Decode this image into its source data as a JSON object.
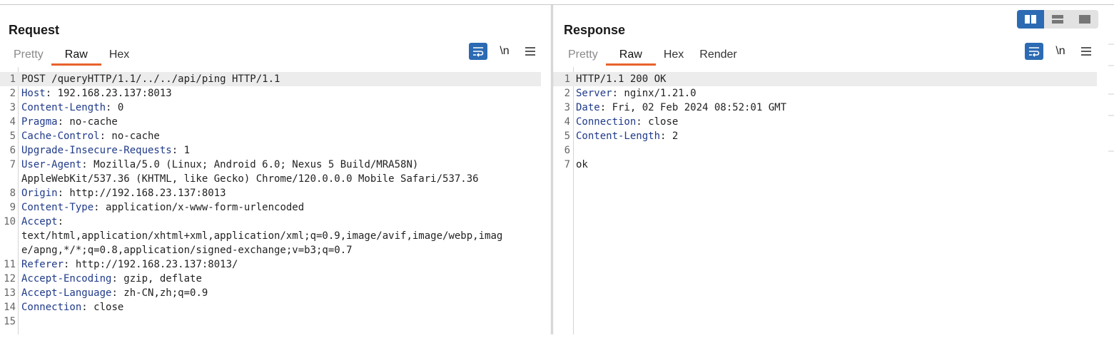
{
  "request": {
    "title": "Request",
    "tabs": [
      "Pretty",
      "Raw",
      "Hex"
    ],
    "active_tab": "Raw",
    "tools": {
      "wrap": "wrap-lines",
      "newline": "\\n",
      "menu": "menu"
    },
    "lines": [
      {
        "n": "1",
        "key": "",
        "text": "POST /queryHTTP/1.1/../../api/ping HTTP/1.1"
      },
      {
        "n": "2",
        "key": "Host",
        "text": ": 192.168.23.137:8013"
      },
      {
        "n": "3",
        "key": "Content-Length",
        "text": ": 0"
      },
      {
        "n": "4",
        "key": "Pragma",
        "text": ": no-cache"
      },
      {
        "n": "5",
        "key": "Cache-Control",
        "text": ": no-cache"
      },
      {
        "n": "6",
        "key": "Upgrade-Insecure-Requests",
        "text": ": 1"
      },
      {
        "n": "7",
        "key": "User-Agent",
        "text": ": Mozilla/5.0 (Linux; Android 6.0; Nexus 5 Build/MRA58N)"
      },
      {
        "n": "",
        "key": "",
        "text": "AppleWebKit/537.36 (KHTML, like Gecko) Chrome/120.0.0.0 Mobile Safari/537.36"
      },
      {
        "n": "8",
        "key": "Origin",
        "text": ": http://192.168.23.137:8013"
      },
      {
        "n": "9",
        "key": "Content-Type",
        "text": ": application/x-www-form-urlencoded"
      },
      {
        "n": "10",
        "key": "Accept",
        "text": ":"
      },
      {
        "n": "",
        "key": "",
        "text": "text/html,application/xhtml+xml,application/xml;q=0.9,image/avif,image/webp,imag"
      },
      {
        "n": "",
        "key": "",
        "text": "e/apng,*/*;q=0.8,application/signed-exchange;v=b3;q=0.7"
      },
      {
        "n": "11",
        "key": "Referer",
        "text": ": http://192.168.23.137:8013/"
      },
      {
        "n": "12",
        "key": "Accept-Encoding",
        "text": ": gzip, deflate"
      },
      {
        "n": "13",
        "key": "Accept-Language",
        "text": ": zh-CN,zh;q=0.9"
      },
      {
        "n": "14",
        "key": "Connection",
        "text": ": close"
      },
      {
        "n": "15",
        "key": "",
        "text": ""
      }
    ]
  },
  "response": {
    "title": "Response",
    "tabs": [
      "Pretty",
      "Raw",
      "Hex",
      "Render"
    ],
    "active_tab": "Raw",
    "tools": {
      "wrap": "wrap-lines",
      "newline": "\\n",
      "menu": "menu"
    },
    "lines": [
      {
        "n": "1",
        "key": "",
        "text": "HTTP/1.1 200 OK"
      },
      {
        "n": "2",
        "key": "Server",
        "text": ": nginx/1.21.0"
      },
      {
        "n": "3",
        "key": "Date",
        "text": ": Fri, 02 Feb 2024 08:52:01 GMT"
      },
      {
        "n": "4",
        "key": "Connection",
        "text": ": close"
      },
      {
        "n": "5",
        "key": "Content-Length",
        "text": ": 2"
      },
      {
        "n": "6",
        "key": "",
        "text": ""
      },
      {
        "n": "7",
        "key": "",
        "text": "ok"
      }
    ]
  },
  "layout_toggle": {
    "options": [
      "side-by-side",
      "stacked",
      "single"
    ],
    "selected": "side-by-side"
  },
  "colors": {
    "accent": "#2c6bb3",
    "tab_underline": "#e8622c",
    "header_key": "#1f3a8a"
  }
}
